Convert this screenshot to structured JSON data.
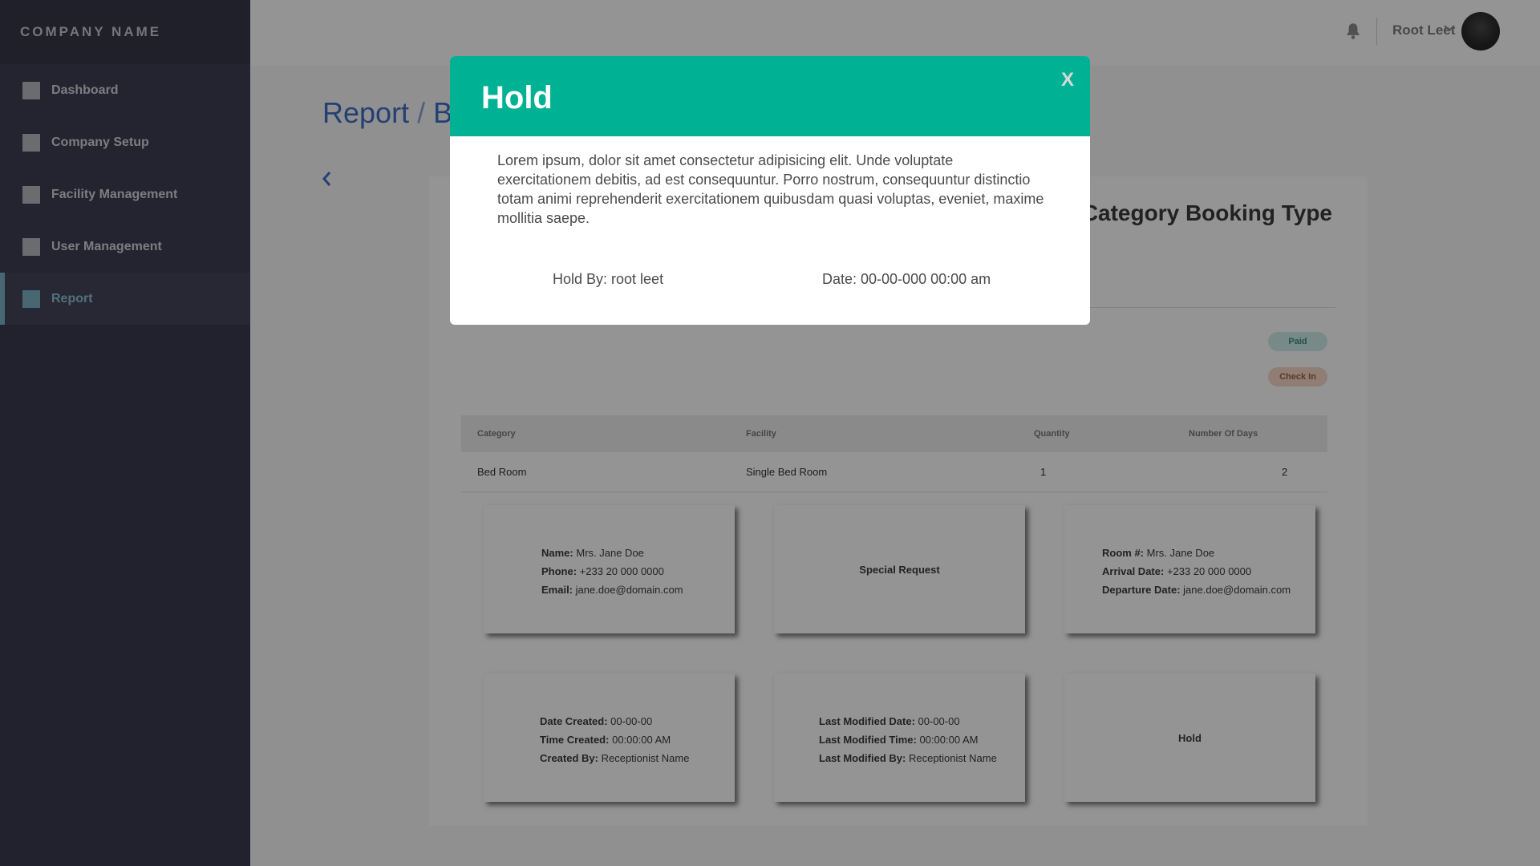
{
  "sidebar": {
    "brand": "COMPANY NAME",
    "items": [
      {
        "label": "Dashboard"
      },
      {
        "label": "Company Setup"
      },
      {
        "label": "Facility Management"
      },
      {
        "label": "User Management"
      },
      {
        "label": "Report"
      }
    ],
    "active": "Report"
  },
  "topbar": {
    "user_name": "Root Leet",
    "icons": [
      "bell-icon",
      "chevron-down-icon"
    ]
  },
  "page": {
    "breadcrumb_root": "Report",
    "breadcrumb_sep": "/",
    "breadcrumb_current": "Bo"
  },
  "card": {
    "title": "Category Booking Type",
    "badges": {
      "paid": "Paid",
      "checkin": "Check In"
    },
    "table": {
      "headers": [
        "Category",
        "Facility",
        "Quantity",
        "Number Of Days"
      ],
      "rows": [
        [
          "Bed Room",
          "Single Bed Room",
          "1",
          "2"
        ]
      ]
    },
    "guest": {
      "name_label": "Name:",
      "name": "Mrs. Jane Doe",
      "phone_label": "Phone:",
      "phone": "+233 20 000 0000",
      "email_label": "Email:",
      "email": "jane.doe@domain.com"
    },
    "special_request": "Special Request",
    "room": {
      "room_label": "Room #:",
      "room": "Mrs. Jane Doe",
      "arrival_label": "Arrival Date:",
      "arrival": "+233 20 000 0000",
      "departure_label": "Departure Date:",
      "departure": "jane.doe@domain.com"
    },
    "created": {
      "date_label": "Date Created:",
      "date": "00-00-00",
      "time_label": "Time Created:",
      "time": "00:00:00 AM",
      "by_label": "Created By:",
      "by": "Receptionist Name"
    },
    "modified": {
      "date_label": "Last Modified Date:",
      "date": "00-00-00",
      "time_label": "Last Modified Time:",
      "time": "00:00:00 AM",
      "by_label": "Last Modified By:",
      "by": "Receptionist Name"
    },
    "status": "Hold"
  },
  "modal": {
    "title": "Hold",
    "close": "X",
    "body": "Lorem ipsum, dolor sit amet consectetur adipisicing elit. Unde voluptate exercitationem debitis, ad est consequuntur. Porro nostrum, consequuntur distinctio totam animi reprehenderit exercitationem quibusdam quasi voluptas, eveniet, maxime mollitia saepe.",
    "hold_by": "Hold By: root leet",
    "date": "Date: 00-00-000 00:00 am"
  },
  "colors": {
    "sidebar": "#3a3b4f",
    "active": "#7fb0c7",
    "modal_header": "#00b194",
    "breadcrumb": "#3f6fc7"
  }
}
